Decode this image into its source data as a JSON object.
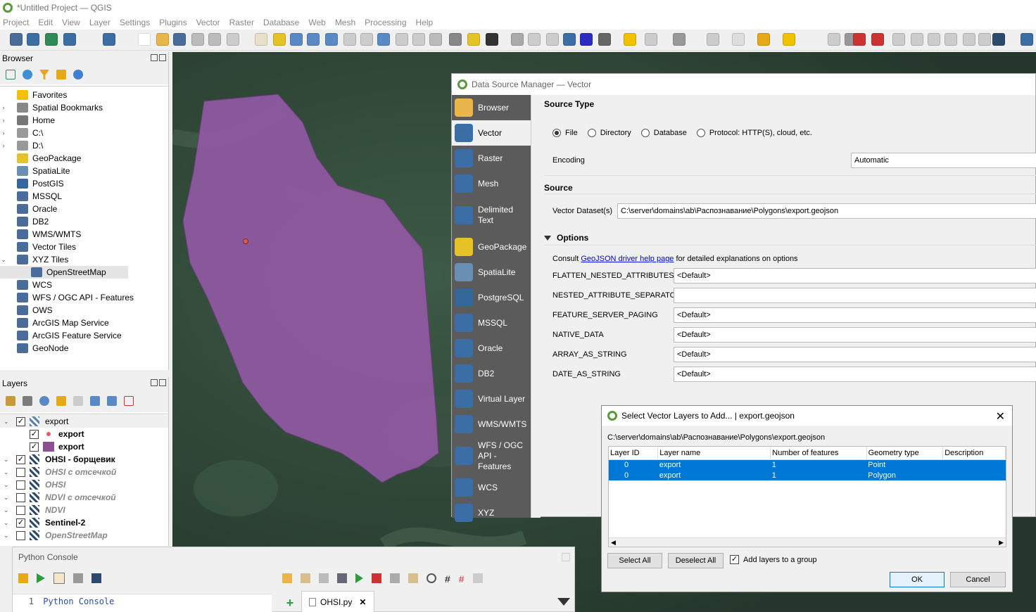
{
  "app": {
    "title": "*Untitled Project — QGIS"
  },
  "menu": [
    "Project",
    "Edit",
    "View",
    "Layer",
    "Settings",
    "Plugins",
    "Vector",
    "Raster",
    "Database",
    "Web",
    "Mesh",
    "Processing",
    "Help"
  ],
  "browser": {
    "title": "Browser",
    "items": [
      {
        "label": "Favorites",
        "expand": "",
        "icon": "star-icon",
        "color": "#f2c200"
      },
      {
        "label": "Spatial Bookmarks",
        "expand": "›",
        "icon": "bookmark-icon",
        "color": "#888"
      },
      {
        "label": "Home",
        "expand": "›",
        "icon": "home-icon",
        "color": "#777"
      },
      {
        "label": "C:\\",
        "expand": "›",
        "icon": "drive-icon",
        "color": "#999"
      },
      {
        "label": "D:\\",
        "expand": "›",
        "icon": "drive-icon",
        "color": "#999"
      },
      {
        "label": "GeoPackage",
        "expand": "",
        "icon": "geopackage-icon",
        "color": "#e6c229"
      },
      {
        "label": "SpatiaLite",
        "expand": "",
        "icon": "spatialite-icon",
        "color": "#6a8fb5"
      },
      {
        "label": "PostGIS",
        "expand": "",
        "icon": "postgis-icon",
        "color": "#336699"
      },
      {
        "label": "MSSQL",
        "expand": "",
        "icon": "mssql-icon",
        "color": "#4a6c9b"
      },
      {
        "label": "Oracle",
        "expand": "",
        "icon": "oracle-icon",
        "color": "#4a6c9b"
      },
      {
        "label": "DB2",
        "expand": "",
        "icon": "db2-icon",
        "color": "#4a6c9b"
      },
      {
        "label": "WMS/WMTS",
        "expand": "",
        "icon": "wms-icon",
        "color": "#4a6c9b"
      },
      {
        "label": "Vector Tiles",
        "expand": "",
        "icon": "vector-tiles-icon",
        "color": "#4a6c9b"
      },
      {
        "label": "XYZ Tiles",
        "expand": "⌄",
        "icon": "xyz-icon",
        "color": "#4a6c9b"
      },
      {
        "label": "OpenStreetMap",
        "expand": "",
        "icon": "grid-icon",
        "color": "#4a6c9b",
        "indent": true,
        "selected": true
      },
      {
        "label": "WCS",
        "expand": "",
        "icon": "wcs-icon",
        "color": "#4a6c9b"
      },
      {
        "label": "WFS / OGC API - Features",
        "expand": "",
        "icon": "wfs-icon",
        "color": "#4a6c9b"
      },
      {
        "label": "OWS",
        "expand": "",
        "icon": "ows-icon",
        "color": "#4a6c9b"
      },
      {
        "label": "ArcGIS Map Service",
        "expand": "",
        "icon": "arcgis-map-icon",
        "color": "#4a6c9b"
      },
      {
        "label": "ArcGIS Feature Service",
        "expand": "",
        "icon": "arcgis-feature-icon",
        "color": "#4a6c9b"
      },
      {
        "label": "GeoNode",
        "expand": "",
        "icon": "geonode-icon",
        "color": "#4a6c9b"
      }
    ]
  },
  "layers": {
    "title": "Layers",
    "items": [
      {
        "label": "export",
        "checked": true,
        "bold": false,
        "italic": false,
        "indent": 0,
        "icon": "group-icon",
        "color": "#5b84b1",
        "grey": false
      },
      {
        "label": "export",
        "checked": true,
        "bold": true,
        "italic": false,
        "indent": 1,
        "icon": "point-symbol-icon",
        "color": "#e06060",
        "grey": false
      },
      {
        "label": "export",
        "checked": true,
        "bold": true,
        "italic": false,
        "indent": 1,
        "icon": "polygon-symbol-icon",
        "color": "#8e4f93",
        "grey": false
      },
      {
        "label": "OHSI - борщевик",
        "checked": true,
        "bold": true,
        "italic": false,
        "indent": 0,
        "icon": "raster-icon",
        "color": "#2c4a6e",
        "grey": false
      },
      {
        "label": "OHSI с отсечкой",
        "checked": false,
        "bold": true,
        "italic": true,
        "indent": 0,
        "icon": "raster-icon",
        "color": "#2c4a6e",
        "grey": true
      },
      {
        "label": "OHSI",
        "checked": false,
        "bold": true,
        "italic": true,
        "indent": 0,
        "icon": "raster-icon",
        "color": "#2c4a6e",
        "grey": true
      },
      {
        "label": "NDVI с отсечкой",
        "checked": false,
        "bold": true,
        "italic": true,
        "indent": 0,
        "icon": "raster-icon",
        "color": "#2c4a6e",
        "grey": true
      },
      {
        "label": "NDVI",
        "checked": false,
        "bold": true,
        "italic": true,
        "indent": 0,
        "icon": "raster-icon",
        "color": "#2c4a6e",
        "grey": true
      },
      {
        "label": "Sentinel-2",
        "checked": true,
        "bold": true,
        "italic": false,
        "indent": 0,
        "icon": "raster-icon",
        "color": "#2c4a6e",
        "grey": false
      },
      {
        "label": "OpenStreetMap",
        "checked": false,
        "bold": true,
        "italic": true,
        "indent": 0,
        "icon": "raster-icon",
        "color": "#2c4a6e",
        "grey": true
      }
    ]
  },
  "python": {
    "title": "Python Console",
    "line_no": "1",
    "code": "Python Console",
    "tab": "OHSI.py"
  },
  "dsm": {
    "title": "Data Source Manager — Vector",
    "side": [
      {
        "label": "Browser",
        "icon": "folder-icon",
        "color": "#e8b64a"
      },
      {
        "label": "Vector",
        "icon": "vector-icon",
        "color": "#3b6ea5",
        "selected": true
      },
      {
        "label": "Raster",
        "icon": "raster-icon",
        "color": "#3b6ea5"
      },
      {
        "label": "Mesh",
        "icon": "mesh-icon",
        "color": "#3b6ea5"
      },
      {
        "label": "Delimited\nText",
        "icon": "delimited-text-icon",
        "color": "#3b6ea5"
      },
      {
        "label": "GeoPackage",
        "icon": "geopackage-icon",
        "color": "#e6c229"
      },
      {
        "label": "SpatiaLite",
        "icon": "spatialite-icon",
        "color": "#6a8fb5"
      },
      {
        "label": "PostgreSQL",
        "icon": "postgresql-icon",
        "color": "#336699"
      },
      {
        "label": "MSSQL",
        "icon": "mssql-icon",
        "color": "#3b6ea5"
      },
      {
        "label": "Oracle",
        "icon": "oracle-icon",
        "color": "#3b6ea5"
      },
      {
        "label": "DB2",
        "icon": "db2-icon",
        "color": "#3b6ea5"
      },
      {
        "label": "Virtual Layer",
        "icon": "virtual-layer-icon",
        "color": "#3b6ea5"
      },
      {
        "label": "WMS/WMTS",
        "icon": "wms-icon",
        "color": "#3b6ea5"
      },
      {
        "label": "WFS / OGC\nAPI -\nFeatures",
        "icon": "wfs-icon",
        "color": "#3b6ea5"
      },
      {
        "label": "WCS",
        "icon": "wcs-icon",
        "color": "#3b6ea5"
      },
      {
        "label": "XYZ",
        "icon": "xyz-icon",
        "color": "#3b6ea5"
      }
    ],
    "source_type": {
      "heading": "Source Type",
      "options": [
        "File",
        "Directory",
        "Database",
        "Protocol: HTTP(S), cloud, etc."
      ],
      "selected": "File",
      "encoding_label": "Encoding",
      "encoding_value": "Automatic"
    },
    "source": {
      "heading": "Source",
      "dataset_label": "Vector Dataset(s)",
      "dataset_value": "C:\\server\\domains\\ab\\Распознавание\\Polygons\\export.geojson"
    },
    "options": {
      "heading": "Options",
      "consult_prefix": "Consult ",
      "consult_link": "GeoJSON driver help page",
      "consult_suffix": " for detailed explanations on options",
      "rows": [
        {
          "label": "FLATTEN_NESTED_ATTRIBUTES",
          "value": "<Default>"
        },
        {
          "label": "NESTED_ATTRIBUTE_SEPARATOR",
          "value": ""
        },
        {
          "label": "FEATURE_SERVER_PAGING",
          "value": "<Default>"
        },
        {
          "label": "NATIVE_DATA",
          "value": "<Default>"
        },
        {
          "label": "ARRAY_AS_STRING",
          "value": "<Default>"
        },
        {
          "label": "DATE_AS_STRING",
          "value": "<Default>"
        }
      ]
    }
  },
  "svl": {
    "title": "Select Vector Layers to Add... | export.geojson",
    "path": "C:\\server\\domains\\ab\\Распознавание\\Polygons\\export.geojson",
    "headers": [
      "Layer ID",
      "Layer name",
      "Number of features",
      "Geometry type",
      "Description"
    ],
    "rows": [
      {
        "id": "0",
        "name": "export",
        "count": "1",
        "geom": "Point",
        "desc": ""
      },
      {
        "id": "0",
        "name": "export",
        "count": "1",
        "geom": "Polygon",
        "desc": ""
      }
    ],
    "select_all": "Select All",
    "deselect_all": "Deselect All",
    "add_group_label": "Add layers to a group",
    "add_group_checked": true,
    "ok": "OK",
    "cancel": "Cancel"
  }
}
